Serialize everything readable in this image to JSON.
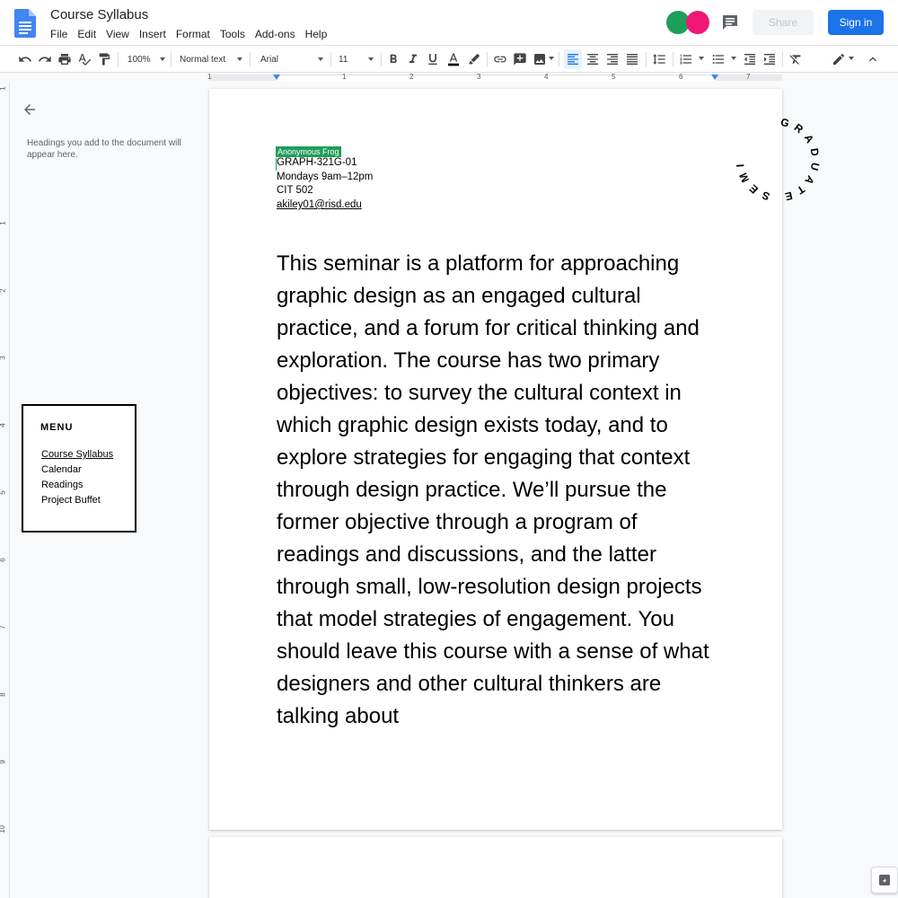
{
  "app": {
    "doc_title": "Course Syllabus",
    "menus": [
      "File",
      "Edit",
      "View",
      "Insert",
      "Format",
      "Tools",
      "Add-ons",
      "Help"
    ],
    "share_label": "Share",
    "signin_label": "Sign in",
    "colors": {
      "accent": "#1a73e8",
      "avatar_green": "#1e9e5b",
      "avatar_pink": "#ef1875"
    }
  },
  "toolbar": {
    "zoom": "100%",
    "style": "Normal text",
    "font": "Arial",
    "size": "11"
  },
  "ruler": {
    "h_numbers": [
      "1",
      "1",
      "2",
      "3",
      "4",
      "5",
      "6",
      "7"
    ],
    "v_numbers": [
      "1",
      "1",
      "2",
      "3",
      "4",
      "5",
      "6",
      "7",
      "8",
      "9",
      "10"
    ]
  },
  "outline": {
    "hint": "Headings you add to the document will appear here."
  },
  "menu": {
    "title": "MENU",
    "links": [
      "Course Syllabus",
      "Calendar",
      "Readings",
      "Project Buffet"
    ]
  },
  "document": {
    "collaborator_tag": "Anonymous Frog",
    "header_lines": [
      "GRAPH-321G-01",
      "Mondays 9am–12pm",
      "CIT 502",
      "akiley01@risd.edu"
    ],
    "body": "This seminar is a platform for approaching graphic design as an engaged cultural practice, and a forum for critical thinking and exploration. The course has two primary objectives: to survey the cultural context in which graphic design exists today, and to explore strategies for engaging that context through design practice. We’ll pursue the former objective through a program of readings and discussions, and the latter through small, low-resolution design projects that model strategies of engagement. You should leave this course with a sense of what designers and other cultural thinkers are talking about",
    "seal_text": "GRADUATE SEMINAR 1"
  }
}
